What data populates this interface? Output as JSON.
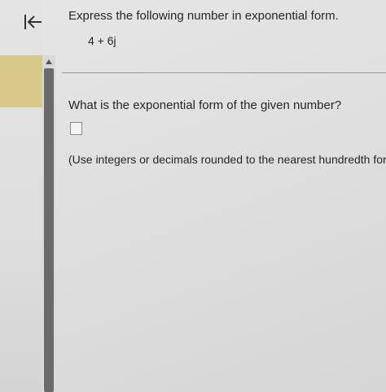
{
  "question": {
    "prompt": "Express the following number in exponential form.",
    "expression": "4 + 6j",
    "ask": "What is the exponential form of the given number?",
    "answer_value": "",
    "instruction": "(Use integers or decimals rounded to the nearest hundredth for ar"
  },
  "icons": {
    "collapse": "collapse-left-arrow-icon",
    "scroll_up": "scroll-up-arrow-icon"
  },
  "colors": {
    "highlight": "#d7c98a",
    "scroll_thumb": "#6a6a6a",
    "text": "#262626"
  }
}
